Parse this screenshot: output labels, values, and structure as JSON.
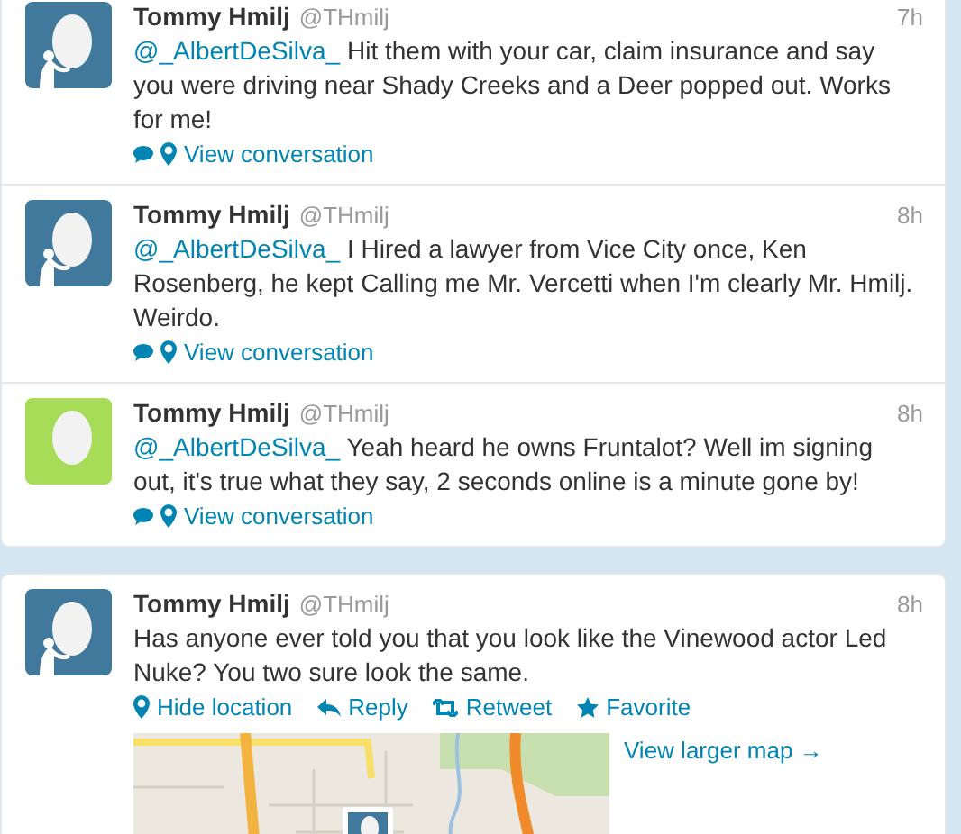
{
  "timeline": [
    {
      "name": "Tommy Hmilj",
      "handle": "@THmilj",
      "time": "7h",
      "avatar": {
        "color": "#41799c",
        "figure": true
      },
      "mention": "@_AlbertDeSilva_",
      "text": "Hit them with your car, claim insurance and say you were driving near Shady Creeks and a Deer popped out. Works for me!",
      "actions": [
        {
          "kind": "conversation",
          "label": "View conversation"
        }
      ]
    },
    {
      "name": "Tommy Hmilj",
      "handle": "@THmilj",
      "time": "8h",
      "avatar": {
        "color": "#41799c",
        "figure": true
      },
      "mention": "@_AlbertDeSilva_",
      "text": "I Hired a lawyer from Vice City once, Ken Rosenberg, he kept Calling me Mr. Vercetti when I'm clearly Mr. Hmilj. Weirdo.",
      "actions": [
        {
          "kind": "conversation",
          "label": "View conversation"
        }
      ]
    },
    {
      "name": "Tommy Hmilj",
      "handle": "@THmilj",
      "time": "8h",
      "avatar": {
        "color": "#a6dc57",
        "figure": false
      },
      "mention": "@_AlbertDeSilva_",
      "text": "Yeah heard he owns Fruntalot? Well im signing out, it's true what they say, 2 seconds online is a minute gone by!",
      "actions": [
        {
          "kind": "conversation",
          "label": "View conversation"
        }
      ]
    }
  ],
  "expanded_tweet": {
    "name": "Tommy Hmilj",
    "handle": "@THmilj",
    "time": "8h",
    "avatar": {
      "color": "#41799c",
      "figure": true
    },
    "text": "Has anyone ever told you that you look like the Vinewood actor Led Nuke? You two sure look the same.",
    "actions": [
      {
        "kind": "location",
        "label": "Hide location"
      },
      {
        "kind": "reply",
        "label": "Reply"
      },
      {
        "kind": "retweet",
        "label": "Retweet"
      },
      {
        "kind": "favorite",
        "label": "Favorite"
      }
    ],
    "map": {
      "kind": "picture",
      "link": "View larger map →"
    }
  }
}
